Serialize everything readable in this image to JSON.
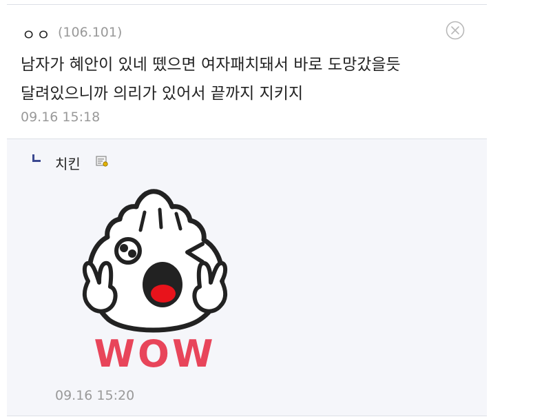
{
  "comment": {
    "nickname": "ㅇㅇ",
    "ip": "(106.101)",
    "text": "남자가 혜안이 있네 뗐으면 여자패치돼서 바로 도망갔을듯\n달려있으니까 의리가 있어서 끝까지 지키지",
    "time": "09.16 15:18",
    "delete_icon": "close-circle-icon"
  },
  "reply": {
    "nickname": "치킨",
    "badge_icon": "fixed-nick-icon",
    "sticker": {
      "name": "dumpling-wow-sticker",
      "text": "WOW",
      "colors": {
        "outline": "#222222",
        "fill": "#ffffff",
        "mouth": "#e8131b",
        "text": "#e8455a"
      }
    },
    "time": "09.16 15:20"
  }
}
